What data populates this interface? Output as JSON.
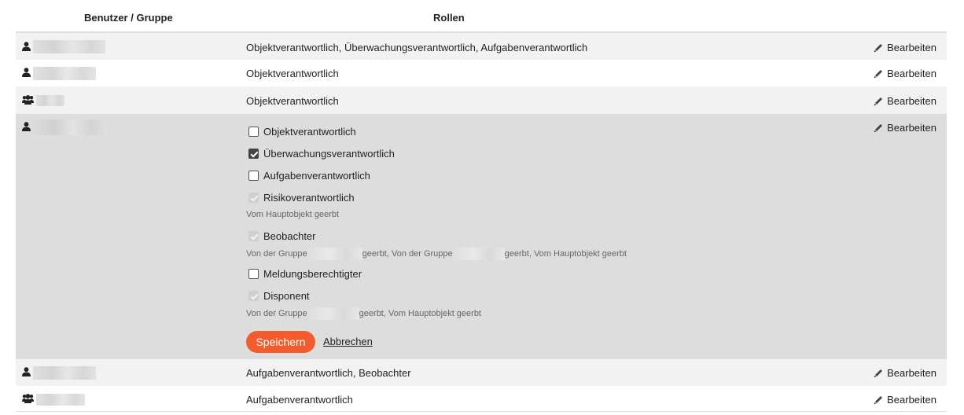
{
  "header": {
    "user_group": "Benutzer / Gruppe",
    "roles": "Rollen"
  },
  "edit_label": "Bearbeiten",
  "rows": [
    {
      "type": "user",
      "roles": "Objektverantwortlich, Überwachungsverantwortlich, Aufgabenverantwortlich"
    },
    {
      "type": "user",
      "roles": "Objektverantwortlich"
    },
    {
      "type": "group",
      "roles": "Objektverantwortlich"
    },
    {
      "type": "user",
      "editing": true
    },
    {
      "type": "user",
      "roles": "Aufgabenverantwortlich, Beobachter"
    },
    {
      "type": "group",
      "roles": "Aufgabenverantwortlich"
    }
  ],
  "editor": {
    "options": [
      {
        "label": "Objektverantwortlich",
        "state": "unchecked"
      },
      {
        "label": "Überwachungsverantwortlich",
        "state": "checked"
      },
      {
        "label": "Aufgabenverantwortlich",
        "state": "unchecked"
      },
      {
        "label": "Risikoverantwortlich",
        "state": "inherited"
      },
      {
        "label": "Beobachter",
        "state": "inherited"
      },
      {
        "label": "Meldungsberechtigter",
        "state": "unchecked"
      },
      {
        "label": "Disponent",
        "state": "inherited"
      }
    ],
    "notes": {
      "risiko": "Vom Hauptobjekt geerbt",
      "beobachter_a": "Von der Gruppe",
      "beobachter_b": "geerbt, Von der Gruppe",
      "beobachter_c": "geerbt, Vom Hauptobjekt geerbt",
      "disponent_a": "Von der Gruppe",
      "disponent_b": "geerbt, Vom Hauptobjekt geerbt"
    },
    "save_label": "Speichern",
    "cancel_label": "Abbrechen"
  },
  "colors": {
    "accent": "#f25c2e",
    "selected_row": "#dddddd",
    "alt_row": "#f2f2f2"
  }
}
